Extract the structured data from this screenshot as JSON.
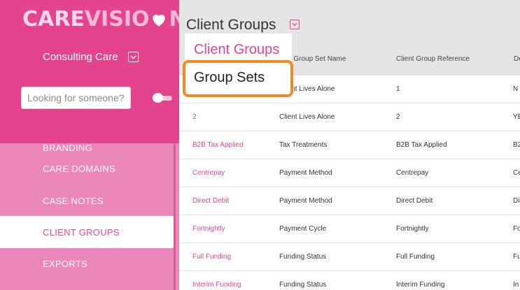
{
  "logo": {
    "text_care": "CARE",
    "text_visio": "VISIO",
    "text_n": "N"
  },
  "org": {
    "name": "Consulting Care"
  },
  "search": {
    "placeholder": "Looking for someone?"
  },
  "nav": {
    "items": [
      "BRANDING",
      "CARE DOMAINS",
      "CASE NOTES",
      "CLIENT GROUPS",
      "EXPORTS"
    ],
    "active": "CLIENT GROUPS"
  },
  "header": {
    "title": "Client Groups"
  },
  "columns": {
    "name": "Client Group Set Name",
    "reference": "Client Group Reference",
    "fourth": "De"
  },
  "menu": {
    "items": [
      "Client Groups",
      "Group Sets"
    ],
    "highlighted": "Group Sets"
  },
  "table": {
    "rows": [
      {
        "name": "",
        "set": "Client Lives Alone",
        "ref": "1",
        "d": "N"
      },
      {
        "name": "2",
        "set": "Client Lives Alone",
        "ref": "2",
        "d": "YE"
      },
      {
        "name": "B2B Tax Applied",
        "set": "Tax Treatments",
        "ref": "B2B Tax Applied",
        "d": "B2"
      },
      {
        "name": "Centrepay",
        "set": "Payment Method",
        "ref": "Centrepay",
        "d": "Ce"
      },
      {
        "name": "Direct Debit",
        "set": "Payment Method",
        "ref": "Direct Debit",
        "d": "Di"
      },
      {
        "name": "Fortnightly",
        "set": "Payment Cycle",
        "ref": "Fortnightly",
        "d": "Fo"
      },
      {
        "name": "Full Funding",
        "set": "Funding Status",
        "ref": "Full Funding",
        "d": "Fu"
      },
      {
        "name": "Interim Funding",
        "set": "Funding Status",
        "ref": "Interim Funding",
        "d": "In"
      }
    ]
  },
  "colors": {
    "brand": "#e4448e",
    "sidebar": "#ec87b9",
    "highlight": "#f08a24"
  }
}
